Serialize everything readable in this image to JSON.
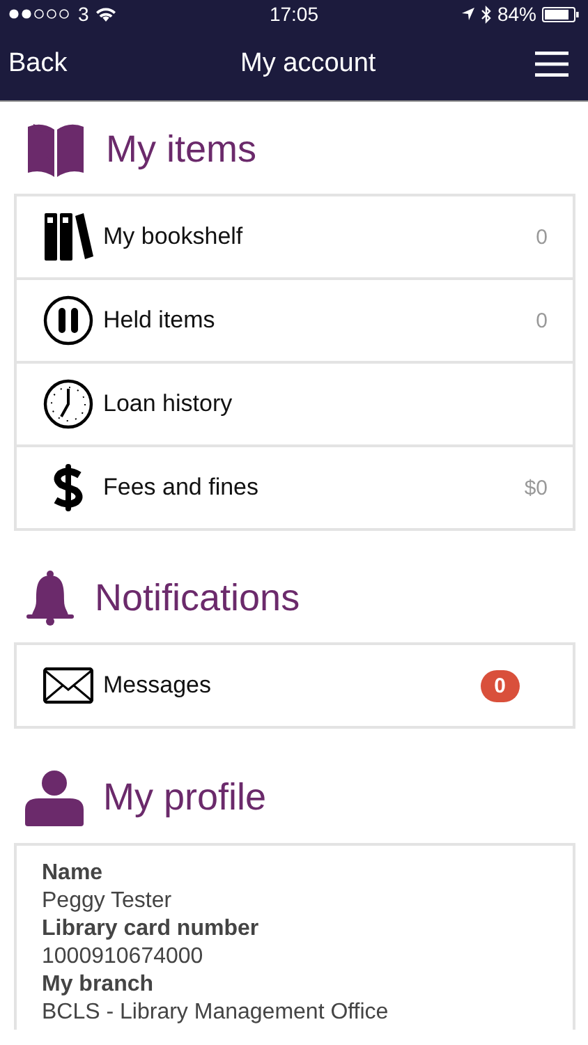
{
  "status_bar": {
    "carrier": "3",
    "time": "17:05",
    "battery": "84%"
  },
  "nav_bar": {
    "back": "Back",
    "title": "My account"
  },
  "sections": [
    {
      "kind": "list",
      "title": "My items",
      "rows": [
        {
          "label": "My bookshelf",
          "value": "0"
        },
        {
          "label": "Held items",
          "value": "0"
        },
        {
          "label": "Loan history"
        },
        {
          "label": "Fees and fines",
          "value": "$0"
        }
      ]
    },
    {
      "kind": "list",
      "title": "Notifications",
      "rows": [
        {
          "label": "Messages",
          "badge": "0"
        }
      ]
    },
    {
      "kind": "details",
      "title": "My profile",
      "fields": [
        {
          "label": "Name",
          "value": "Peggy Tester"
        },
        {
          "label": "Library card number",
          "value": "1000910674000"
        },
        {
          "label": "My branch",
          "value": "BCLS - Library Management Office"
        }
      ]
    }
  ]
}
